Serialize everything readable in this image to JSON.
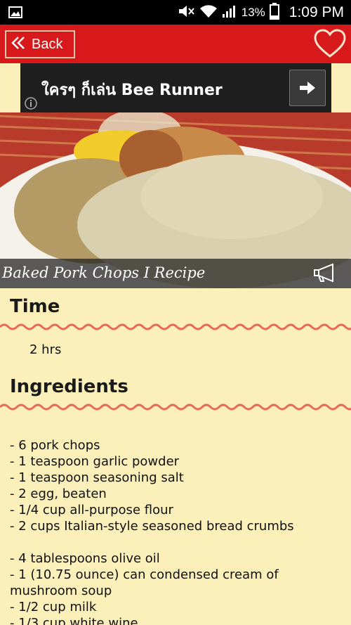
{
  "status_bar": {
    "battery_percent": "13%",
    "time": "1:09 PM"
  },
  "app_bar": {
    "back_label": "Back"
  },
  "ad": {
    "text": "ใครๆ ก็เล่น Bee Runner"
  },
  "recipe": {
    "title": "Baked Pork Chops I Recipe",
    "time_heading": "Time",
    "time_value": "2 hrs",
    "ingredients_heading": "Ingredients",
    "ingredients": [
      "-  6 pork chops",
      "-  1 teaspoon garlic powder",
      "-  1 teaspoon seasoning salt",
      "-  2 egg, beaten",
      "-  1/4 cup all-purpose flour",
      "-  2 cups Italian-style seasoned bread crumbs",
      "",
      "-  4 tablespoons olive oil",
      "-  1 (10.75 ounce) can condensed cream of",
      "mushroom soup",
      "-  1/2 cup milk",
      "-  1/3 cup white wine"
    ]
  },
  "colors": {
    "app_bar": "#d7191c",
    "background": "#fbefba",
    "wave": "#e8695a"
  }
}
